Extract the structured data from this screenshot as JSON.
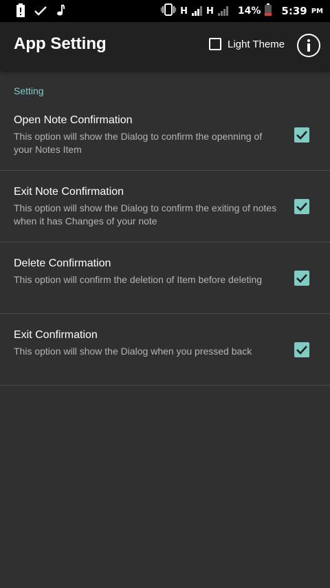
{
  "status_bar": {
    "network_1": "H",
    "network_2": "H",
    "battery": "14%",
    "time": "5:39",
    "ampm": "PM",
    "icons": [
      "battery-alert-icon",
      "check-icon",
      "music-note-icon",
      "vibrate-icon",
      "signal-icon"
    ]
  },
  "app_bar": {
    "title": "App Setting",
    "light_theme_label": "Light Theme",
    "light_theme_checked": false,
    "info_icon": "info-icon"
  },
  "section": {
    "header": "Setting"
  },
  "settings": [
    {
      "title": "Open Note Confirmation",
      "description": "This option will show the Dialog to confirm the openning of your Notes Item",
      "checked": true
    },
    {
      "title": "Exit Note Confirmation",
      "description": "This option will show the Dialog to confirm the exiting of notes when it has Changes of your note",
      "checked": true
    },
    {
      "title": "Delete Confirmation",
      "description": "This option will confirm the deletion of Item before deleting",
      "checked": true
    },
    {
      "title": "Exit Confirmation",
      "description": "This option will show the Dialog when you pressed back",
      "checked": true
    }
  ],
  "colors": {
    "accent": "#80cbc4",
    "background": "#303030",
    "app_bar": "#212121"
  }
}
